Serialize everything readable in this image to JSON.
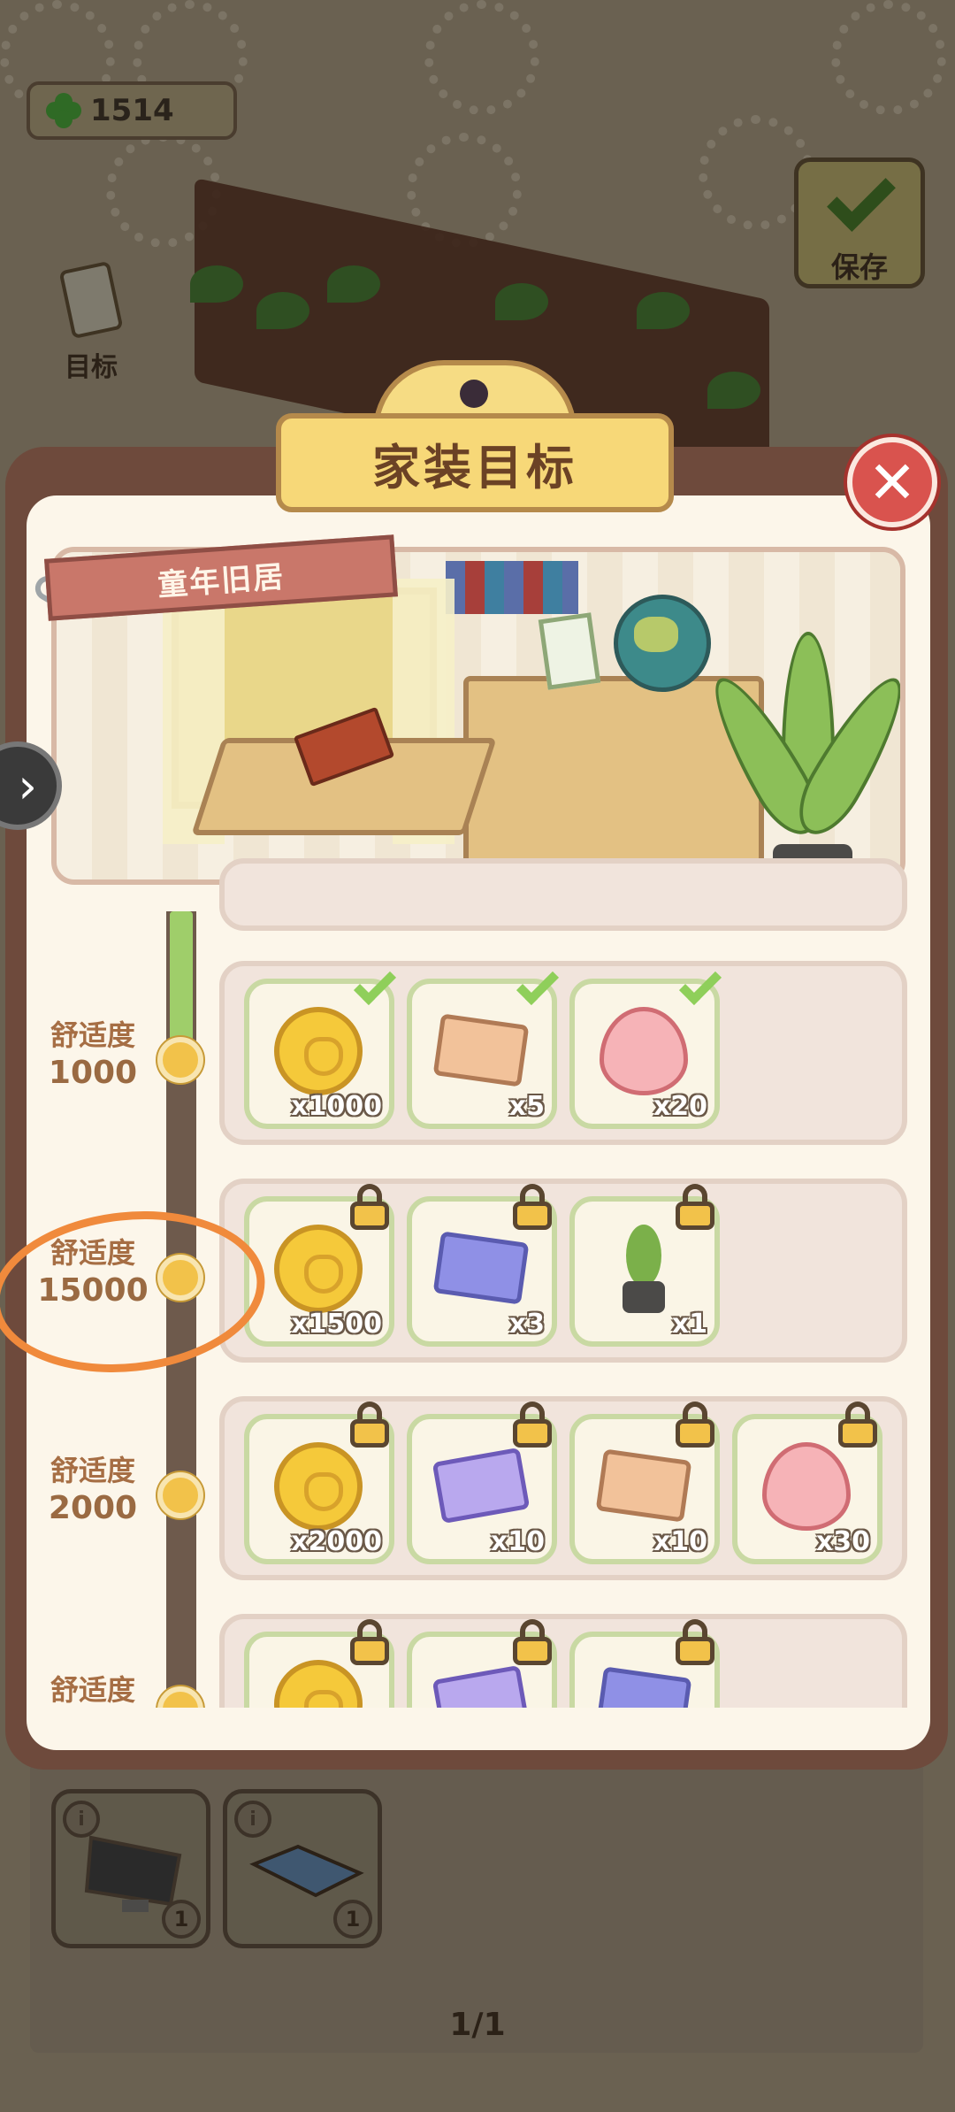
{
  "hud": {
    "currency_value": "1514",
    "currency_icon": "clover-icon",
    "save_label": "保存",
    "goal_label": "目标"
  },
  "modal": {
    "title": "家装目标",
    "room_name": "童年旧居",
    "close_icon": "close-icon",
    "nav_arrow": "›"
  },
  "tiers": [
    {
      "label": "舒适度",
      "value": "1000",
      "rewards": [
        {
          "icon": "coin-icon",
          "qty": "x1000",
          "state": "claimed"
        },
        {
          "icon": "ticket-icon",
          "qty": "x5",
          "state": "claimed"
        },
        {
          "icon": "heart-icon",
          "qty": "x20",
          "state": "claimed"
        }
      ]
    },
    {
      "label": "舒适度",
      "value": "15000",
      "rewards": [
        {
          "icon": "coin-icon",
          "qty": "x1500",
          "state": "locked"
        },
        {
          "icon": "blue-ticket-icon",
          "qty": "x3",
          "state": "locked"
        },
        {
          "icon": "potted-plant-icon",
          "qty": "x1",
          "state": "locked"
        }
      ]
    },
    {
      "label": "舒适度",
      "value": "2000",
      "rewards": [
        {
          "icon": "coin-icon",
          "qty": "x2000",
          "state": "locked"
        },
        {
          "icon": "coral-ticket-icon",
          "qty": "x10",
          "state": "locked"
        },
        {
          "icon": "ticket-icon",
          "qty": "x10",
          "state": "locked"
        },
        {
          "icon": "heart-icon",
          "qty": "x30",
          "state": "locked"
        }
      ]
    },
    {
      "label": "舒适度",
      "value": "",
      "rewards": [
        {
          "icon": "coin-icon",
          "qty": "",
          "state": "locked"
        },
        {
          "icon": "coral-ticket-icon",
          "qty": "",
          "state": "locked"
        },
        {
          "icon": "blue-ticket-icon",
          "qty": "",
          "state": "locked"
        }
      ]
    }
  ],
  "inventory": {
    "items": [
      {
        "icon": "monitor-icon",
        "count": "1"
      },
      {
        "icon": "keyboard-icon",
        "count": "1"
      }
    ],
    "pager": "1/1"
  }
}
